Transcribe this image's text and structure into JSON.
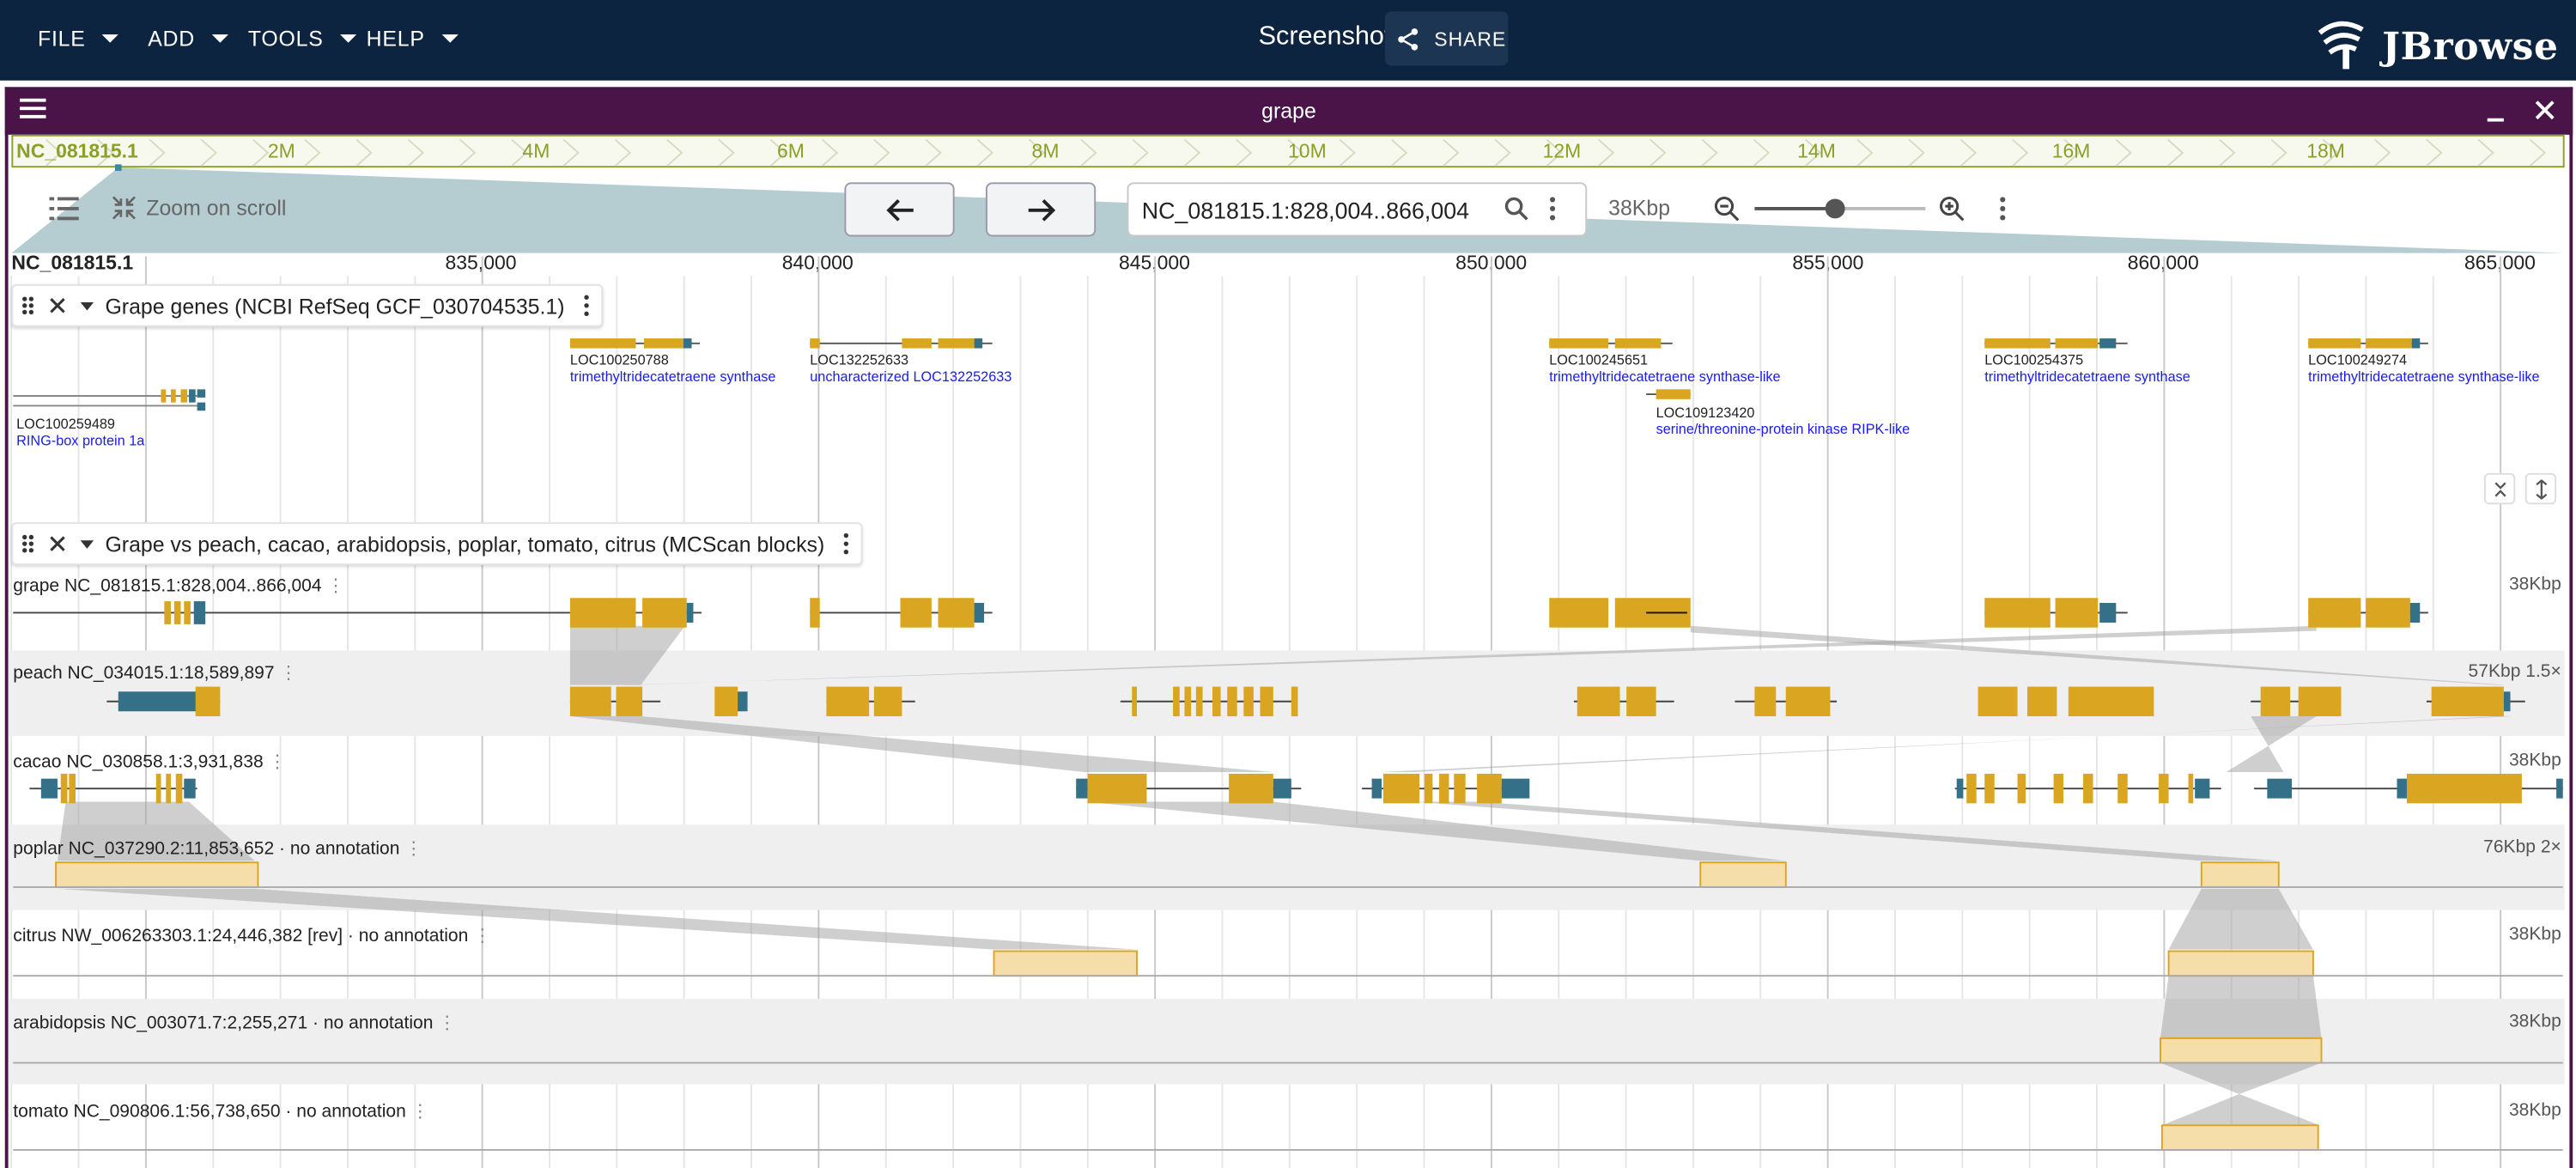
{
  "appbar": {
    "menus": [
      "FILE",
      "ADD",
      "TOOLS",
      "HELP"
    ],
    "title": "Screenshot",
    "share_label": "SHARE",
    "logo_text": "JBrowse"
  },
  "view": {
    "name": "grape",
    "overview": {
      "refname": "NC_081815.1",
      "labels": [
        "2M",
        "4M",
        "6M",
        "8M",
        "10M",
        "12M",
        "14M",
        "16M",
        "18M"
      ]
    },
    "toolbar": {
      "zoom_on_scroll_label": "Zoom on scroll",
      "location": "NC_081815.1:828,004..866,004",
      "span": "38Kbp"
    },
    "ruler": {
      "refname": "NC_081815.1",
      "ticks": [
        "835,000",
        "840,000",
        "845,000",
        "850,000",
        "855,000",
        "860,000",
        "865,000"
      ]
    }
  },
  "tracks": {
    "genes": {
      "title": "Grape genes (NCBI RefSeq GCF_030704535.1)",
      "features": [
        {
          "name": "LOC100259489",
          "desc": "RING-box protein 1a"
        },
        {
          "name": "LOC100250788",
          "desc": "trimethyltridecatetraene synthase"
        },
        {
          "name": "LOC132252633",
          "desc": "uncharacterized LOC132252633"
        },
        {
          "name": "LOC100245651",
          "desc": "trimethyltridecatetraene synthase-like"
        },
        {
          "name": "LOC109123420",
          "desc": "serine/threonine-protein kinase RIPK-like"
        },
        {
          "name": "LOC100254375",
          "desc": "trimethyltridecatetraene synthase"
        },
        {
          "name": "LOC100249274",
          "desc": "trimethyltridecatetraene synthase-like"
        }
      ]
    },
    "synteny": {
      "title": "Grape vs peach, cacao, arabidopsis, poplar, tomato, citrus (MCScan blocks)",
      "rows": [
        {
          "label": "grape NC_081815.1:828,004..866,004",
          "right": "38Kbp"
        },
        {
          "label": "peach NC_034015.1:18,589,897",
          "right": "57Kbp 1.5×"
        },
        {
          "label": "cacao NC_030858.1:3,931,838",
          "right": "38Kbp"
        },
        {
          "label": "poplar NC_037290.2:11,853,652 · no annotation",
          "right": "76Kbp 2×"
        },
        {
          "label": "citrus NW_006263303.1:24,446,382 [rev] · no annotation",
          "right": "38Kbp"
        },
        {
          "label": "arabidopsis NC_003071.7:2,255,271 · no annotation",
          "right": "38Kbp"
        },
        {
          "label": "tomato NC_090806.1:56,738,650 · no annotation",
          "right": "38Kbp"
        }
      ]
    }
  },
  "colors": {
    "appbar": "#0c2440",
    "view_header": "#4a1448",
    "cds": "#daa520",
    "utr": "#357089",
    "overview": "#8aa027",
    "link_text": "#1a1aff"
  }
}
